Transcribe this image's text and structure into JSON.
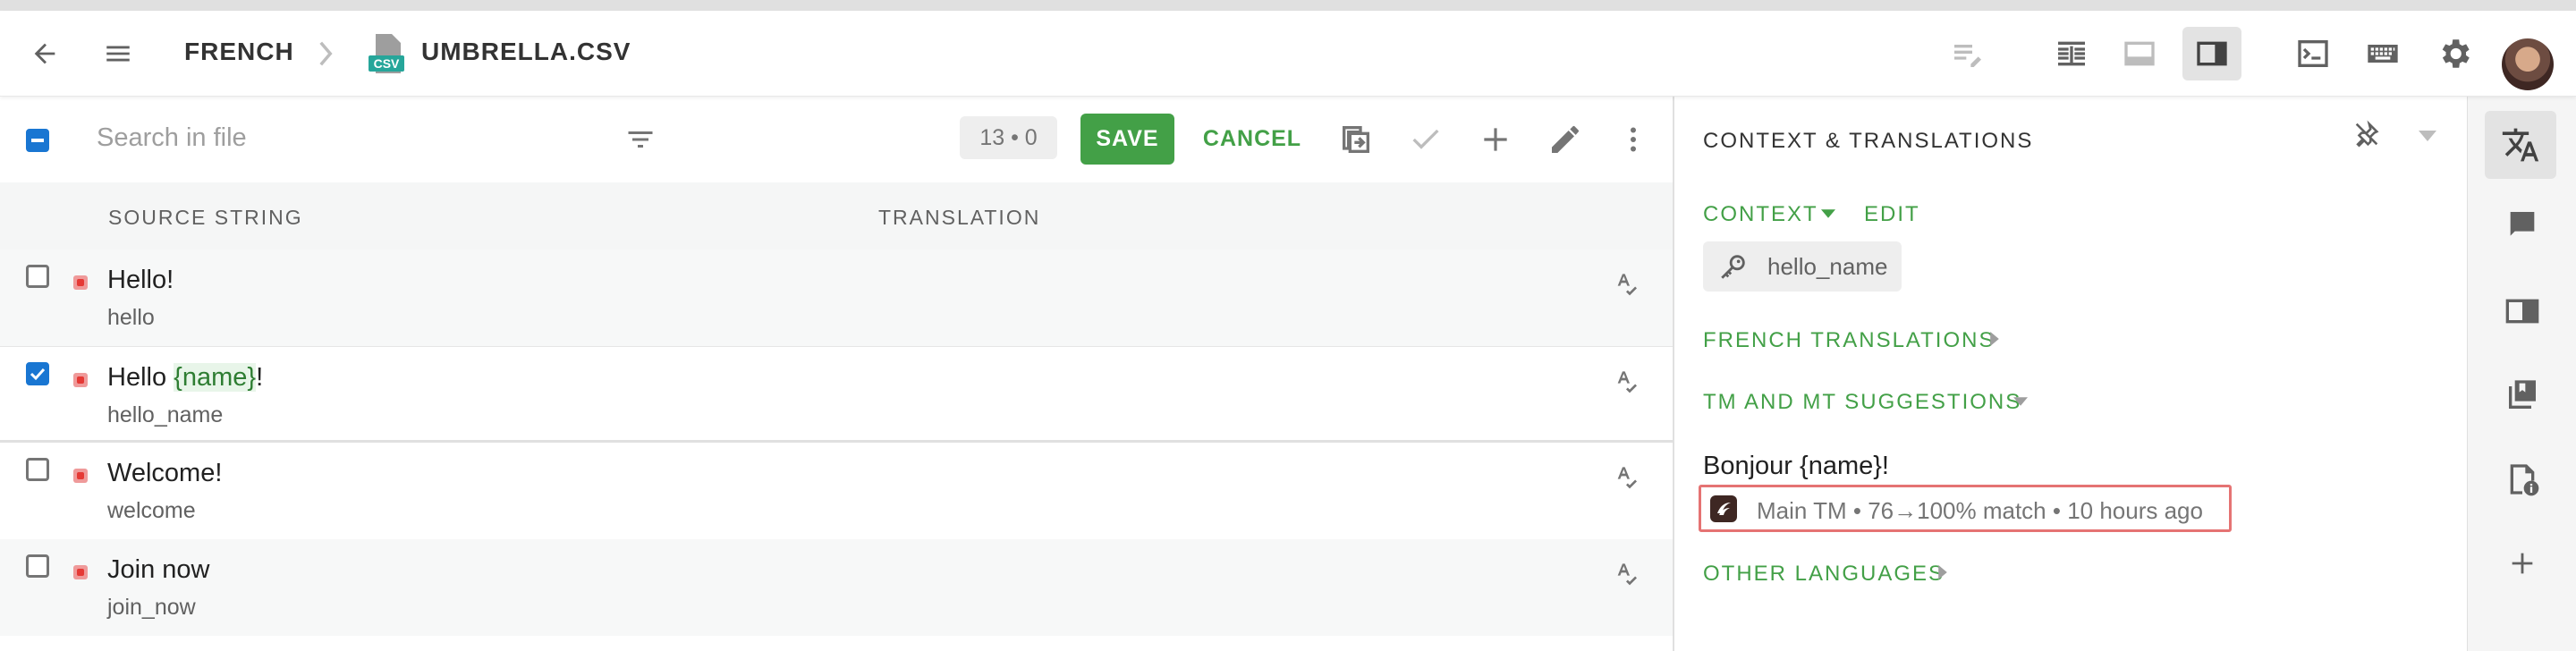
{
  "header": {
    "project_crumb": "FRENCH",
    "file_name": "UMBRELLA.CSV",
    "file_badge": "CSV",
    "icons": [
      "back-arrow-icon",
      "menu-icon",
      "chevron-right-icon",
      "csv-file-icon",
      "editor-mode-icon",
      "side-by-side-icon",
      "horizontal-layout-icon",
      "panel-layout-icon",
      "terminal-icon",
      "keyboard-icon",
      "settings-gear-icon",
      "avatar"
    ]
  },
  "toolbar": {
    "search_placeholder": "Search in file",
    "counter": "13 • 0",
    "save_label": "SAVE",
    "cancel_label": "CANCEL"
  },
  "table": {
    "columns": [
      "SOURCE STRING",
      "TRANSLATION"
    ],
    "rows": [
      {
        "source": "Hello!",
        "key": "hello",
        "checked": false
      },
      {
        "source_prefix": "Hello ",
        "placeholder": "{name}",
        "source_suffix": "!",
        "key": "hello_name",
        "checked": true
      },
      {
        "source": "Welcome!",
        "key": "welcome",
        "checked": false
      },
      {
        "source": "Join now",
        "key": "join_now",
        "checked": false
      }
    ]
  },
  "panel": {
    "title": "CONTEXT & TRANSLATIONS",
    "context_label": "CONTEXT",
    "edit_label": "EDIT",
    "context_key": "hello_name",
    "french_translations_label": "FRENCH TRANSLATIONS",
    "tm_label": "TM AND MT SUGGESTIONS",
    "suggestion": "Bonjour {name}!",
    "tm_meta": "Main TM  •  76→100% match  •  10 hours ago",
    "other_languages_label": "OTHER LANGUAGES"
  },
  "colors": {
    "accent_green": "#43a047",
    "selected_blue": "#1976d2",
    "highlight_red": "#e57373"
  }
}
